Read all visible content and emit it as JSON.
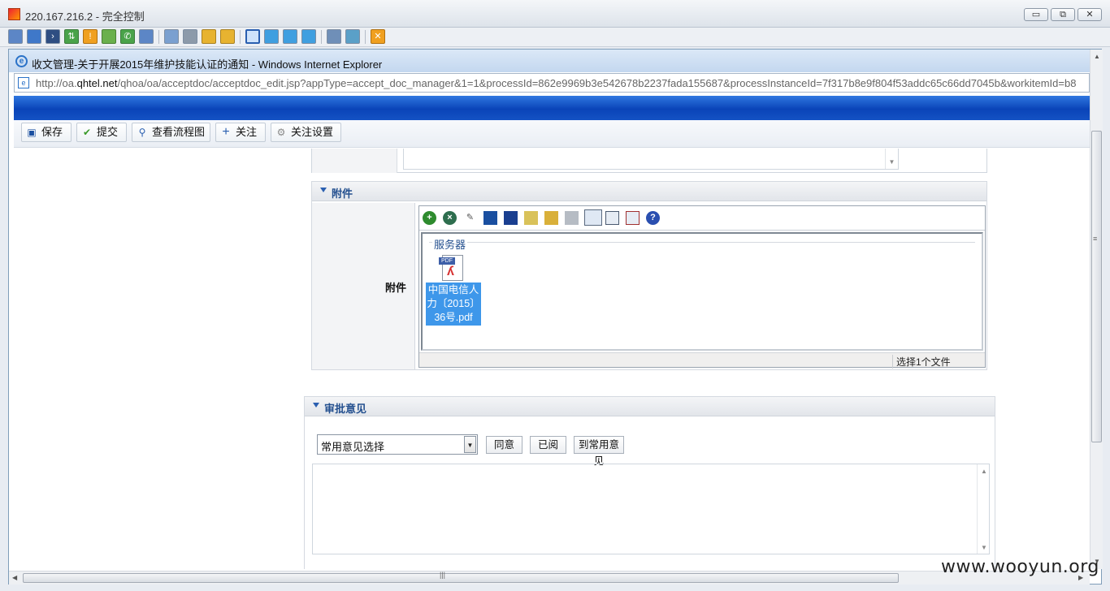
{
  "outer_window": {
    "title": "220.167.216.2 - 完全控制",
    "controls": {
      "minimize": "▭",
      "restore": "⧉",
      "close": "✕"
    }
  },
  "ie_window": {
    "title": "收文管理-关于开展2015年维护技能认证的通知 - Windows Internet Explorer",
    "address_prefix": "http://oa.",
    "address_domain": "qhtel.net",
    "address_path": "/qhoa/oa/acceptdoc/acceptdoc_edit.jsp?appType=accept_doc_manager&1=1&processId=862e9969b3e542678b2237fada155687&processInstanceId=7f317b8e9f804f53addc65c66dd7045b&workitemId=b8"
  },
  "oa_toolbar": {
    "save": "保存",
    "submit": "提交",
    "view_flow": "查看流程图",
    "follow": "关注",
    "follow_settings": "关注设置"
  },
  "attachment_section": {
    "header": "附件",
    "row_label": "附件",
    "server_label": "服务器",
    "file_name": "中国电信人力〔2015〕36号.pdf",
    "file_lines": [
      "中国电信人",
      "力〔2015〕",
      "36号.pdf"
    ],
    "status": "选择1个文件",
    "pdf_tag": "PDF"
  },
  "approval_section": {
    "header": "审批意见",
    "select_value": "常用意见选择",
    "agree": "同意",
    "read": "已阅",
    "to_common": "到常用意见"
  },
  "watermark": "www.wooyun.org",
  "colors": {
    "band_blue": "#0a44b8",
    "section_title": "#24508f",
    "file_highlight": "#3e97ea"
  }
}
